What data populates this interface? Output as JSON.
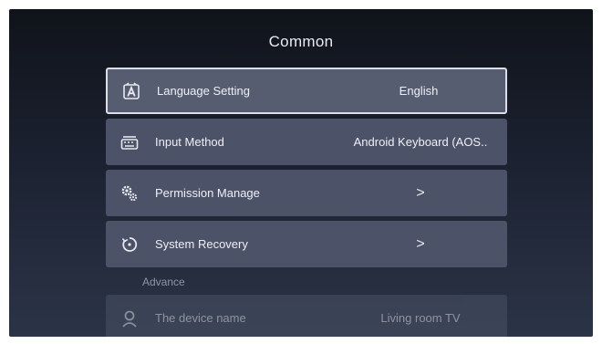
{
  "screen_title": "Common",
  "items": [
    {
      "icon": "language-icon",
      "label": "Language Setting",
      "value": "English"
    },
    {
      "icon": "keyboard-icon",
      "label": "Input Method",
      "value": "Android Keyboard (AOS.."
    },
    {
      "icon": "permission-gear-icon",
      "label": "Permission Manage",
      "chevron": ">"
    },
    {
      "icon": "recovery-icon",
      "label": "System Recovery",
      "chevron": ">"
    }
  ],
  "advance": {
    "section_label": "Advance",
    "device_name": {
      "icon": "person-icon",
      "label": "The device name",
      "value": "Living room TV"
    }
  },
  "colors": {
    "item_background": "#4c5368",
    "focus_border": "#dcdfe6",
    "text": "#eef0f5"
  }
}
